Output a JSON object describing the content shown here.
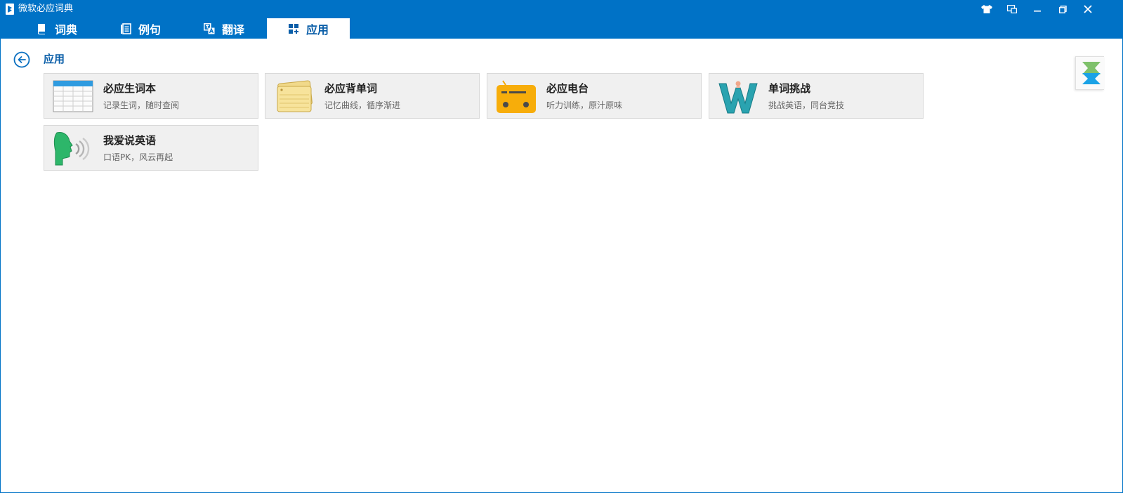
{
  "window": {
    "title": "微软必应词典",
    "controls": [
      "skin-icon",
      "mini-mode-icon",
      "minimize-icon",
      "restore-icon",
      "close-icon"
    ]
  },
  "tabs": [
    {
      "label": "词典",
      "icon": "book-icon",
      "active": false
    },
    {
      "label": "例句",
      "icon": "sentences-icon",
      "active": false
    },
    {
      "label": "翻译",
      "icon": "translate-icon",
      "active": false
    },
    {
      "label": "应用",
      "icon": "apps-icon",
      "active": true
    }
  ],
  "page": {
    "title": "应用",
    "back_icon": "back-arrow-icon"
  },
  "apps": [
    {
      "title": "必应生词本",
      "subtitle": "记录生词，随时查阅",
      "icon": "wordbook-icon"
    },
    {
      "title": "必应背单词",
      "subtitle": "记忆曲线，循序渐进",
      "icon": "flashcards-icon"
    },
    {
      "title": "必应电台",
      "subtitle": "听力训练，原汁原味",
      "icon": "radio-icon"
    },
    {
      "title": "单词挑战",
      "subtitle": "挑战英语，同台竞技",
      "icon": "word-challenge-icon"
    },
    {
      "title": "我爱说英语",
      "subtitle": "口语PK，风云再起",
      "icon": "speaking-icon"
    }
  ],
  "colors": {
    "accent": "#0072c6",
    "active_tab_text": "#0a5ea8",
    "card_bg": "#f0f0f0",
    "card_border": "#d8d8d8"
  }
}
